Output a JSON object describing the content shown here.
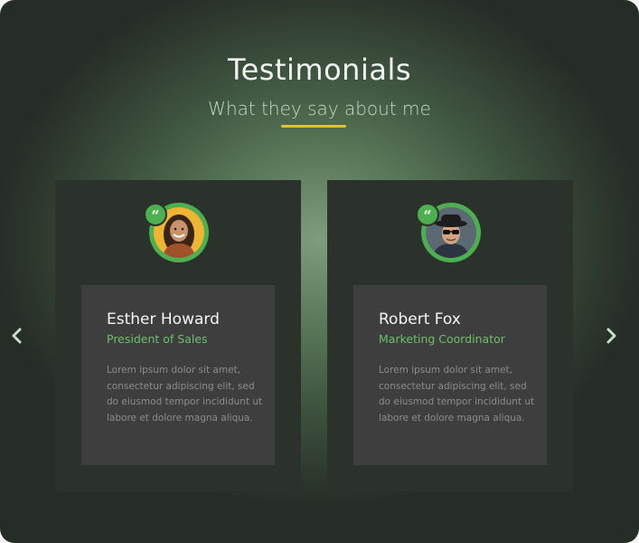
{
  "header": {
    "title": "Testimonials",
    "subtitle": "What they say about me"
  },
  "colors": {
    "accent_green": "#4caf50",
    "role_green": "#6bc16a",
    "underline_yellow": "#e2c233",
    "card_bg": "#2a322b",
    "inner_bg": "#3e3e3e"
  },
  "testimonials": [
    {
      "name": "Esther Howard",
      "role": "President of Sales",
      "text": "Lorem ipsum dolor sit amet, consectetur adipiscing elit, sed do eiusmod tempor incididunt ut labore et dolore magna aliqua.",
      "avatar": "woman-avatar",
      "quote_icon": "quote-icon"
    },
    {
      "name": "Robert Fox",
      "role": "Marketing Coordinator",
      "text": "Lorem ipsum dolor sit amet, consectetur adipiscing elit, sed do eiusmod tempor incididunt ut labore et dolore magna aliqua.",
      "avatar": "man-avatar",
      "quote_icon": "quote-icon"
    }
  ],
  "nav": {
    "prev_icon": "chevron-left-icon",
    "next_icon": "chevron-right-icon"
  }
}
